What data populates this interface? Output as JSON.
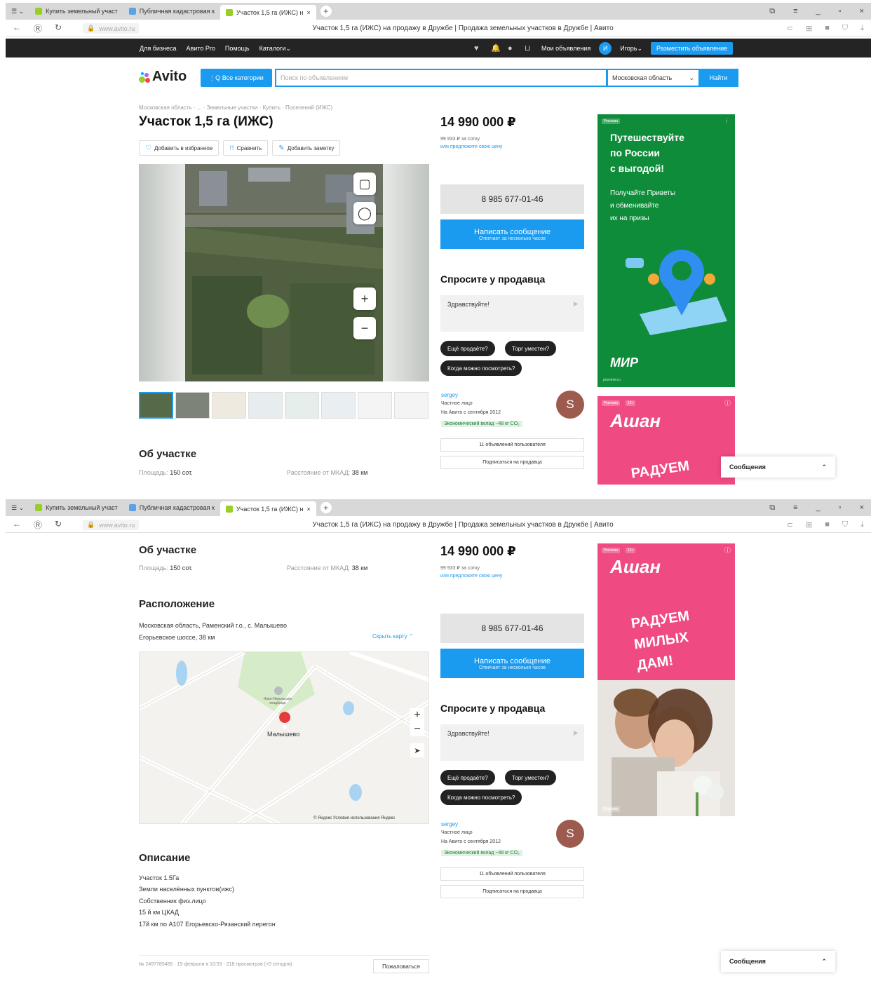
{
  "browser": {
    "tabs": [
      {
        "label": "Купить земельный участ"
      },
      {
        "label": "Публичная кадастровая к"
      },
      {
        "label": "Участок 1,5 га (ИЖС) н"
      }
    ],
    "url": "www.avito.ru",
    "page_title": "Участок 1,5 га (ИЖС) на продажу в Дружбе | Продажа земельных участков в Дружбе | Авито"
  },
  "topnav": {
    "links": [
      "Для бизнеса",
      "Авито Pro",
      "Помощь",
      "Каталоги"
    ],
    "my_ads": "Мои объявления",
    "avatar_letter": "И",
    "user_name": "Игорь",
    "post_button": "Разместить объявление"
  },
  "header": {
    "logo": "Avito",
    "categories_button": "Все категории",
    "search_placeholder": "Поиск по объявлениям",
    "region": "Московская область",
    "find_button": "Найти"
  },
  "breadcrumbs": "Московская область  ·  ...  ·  Земельные участки  ·  Купить  ·  Поселений (ИЖС)",
  "listing": {
    "title": "Участок 1,5 га (ИЖС)",
    "actions": [
      "Добавить в избранное",
      "Сравнить",
      "Добавить заметку"
    ],
    "price": "14 990 000 ₽",
    "price_per": "99 933 ₽ за сотку",
    "offer_price": "или предложите свою цену",
    "phone": "8 985 677-01-46",
    "write_message": "Написать сообщение",
    "write_sub": "Отвечает за несколько часов",
    "ask_title": "Спросите у продавца",
    "ask_text": "Здравствуйте!",
    "chips": [
      "Ещё продаёте?",
      "Торг уместен?",
      "Когда можно посмотреть?"
    ],
    "seller_name": "sergey",
    "seller_type": "Частное лицо",
    "seller_since": "На Авито с сентября 2012",
    "eco": "Экономический вклад −48 кг CO₂",
    "seller_letter": "S",
    "seller_ads": "11 объявлений пользователя",
    "subscribe": "Подписаться на продавца"
  },
  "about": {
    "title": "Об участке",
    "area_label": "Площадь:",
    "area_value": "150 сот.",
    "mkad_label": "Расстояние от МКАД:",
    "mkad_value": "38 км"
  },
  "location": {
    "title": "Расположение",
    "address_1": "Московская область, Раменский г.о., с. Малышево",
    "address_2": "Егорьевское шоссе, 38 км",
    "hide_map": "Скрыть карту",
    "village_label": "Малышево",
    "cemetery_label": "Ново-Никольское кладбище",
    "map_credit": "© Яндекс Условия использования  Яндекс"
  },
  "description": {
    "title": "Описание",
    "text": "Участок 1.5Га\nЗемли населённых пунктов(ижс)\nСобственник физ.лицо\n15 й км ЦКАД\n17й км по А107 Егорьевско-Рязанский перегон"
  },
  "footer": {
    "meta": "№ 2497785455 · 19 февраля в 10:53 · 218 просмотров (+0 сегодня)",
    "complain": "Пожаловаться"
  },
  "ads": {
    "tag": "Реклама",
    "age": "12+",
    "mir_heading_1": "Путешествуйте",
    "mir_heading_2": "по России",
    "mir_heading_3": "с выгодой!",
    "mir_sub_1": "Получайте Приветы",
    "mir_sub_2": "и обменивайте",
    "mir_sub_3": "их на призы",
    "mir_logo": "МИР",
    "mir_small": "privetmir.ru",
    "ashan_logo": "Ашан",
    "ashan_1": "РАДУЕМ",
    "ashan_2": "МИЛЫХ",
    "ashan_3": "ДАМ!"
  },
  "messages": {
    "label": "Сообщения"
  },
  "colors": {
    "accent": "#1a9bf0",
    "dark": "#242424",
    "mir_green": "#0e8c3a",
    "ashan_pink": "#ef4a82"
  }
}
